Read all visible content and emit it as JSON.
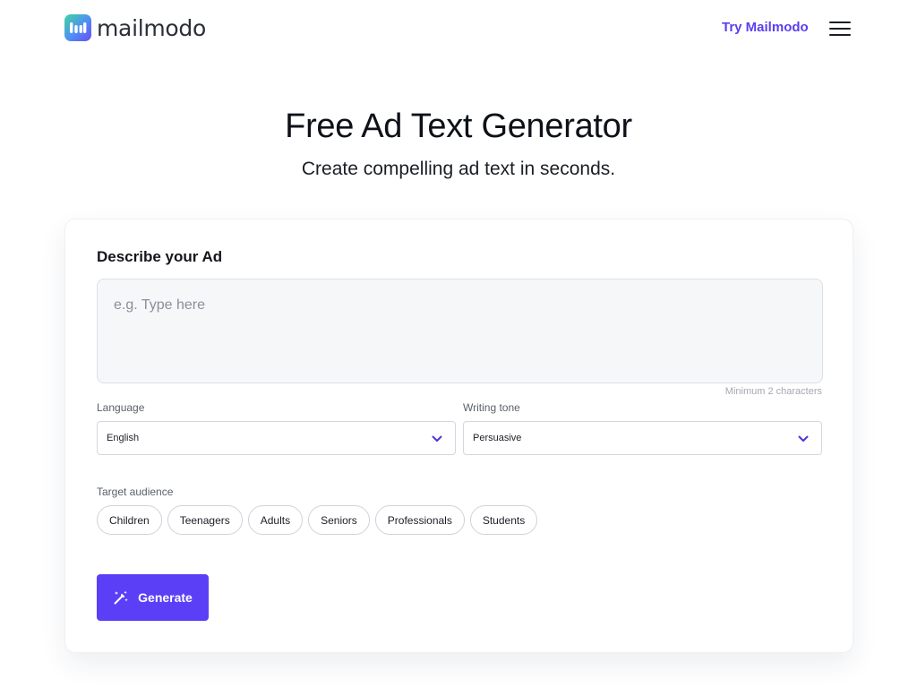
{
  "header": {
    "brand": "mailmodo",
    "cta_label": "Try Mailmodo",
    "menu_icon": "hamburger-menu-icon"
  },
  "hero": {
    "title": "Free Ad Text Generator",
    "subtitle": "Create compelling ad text in seconds."
  },
  "form": {
    "title": "Describe your Ad",
    "description": {
      "placeholder": "e.g. Type here",
      "value": "",
      "hint": "Minimum 2 characters"
    },
    "language": {
      "label": "Language",
      "value": "English"
    },
    "tone": {
      "label": "Writing tone",
      "value": "Persuasive"
    },
    "audience": {
      "label": "Target audience",
      "options": [
        "Children",
        "Teenagers",
        "Adults",
        "Seniors",
        "Professionals",
        "Students"
      ]
    },
    "generate_label": "Generate"
  },
  "colors": {
    "accent": "#5b3ff6",
    "link": "#5b3ff0",
    "input_bg": "#f6f7f9",
    "border": "#d3d7de"
  },
  "icons": [
    "mailmodo-logo-icon",
    "hamburger-menu-icon",
    "chevron-down-icon",
    "magic-wand-icon"
  ]
}
